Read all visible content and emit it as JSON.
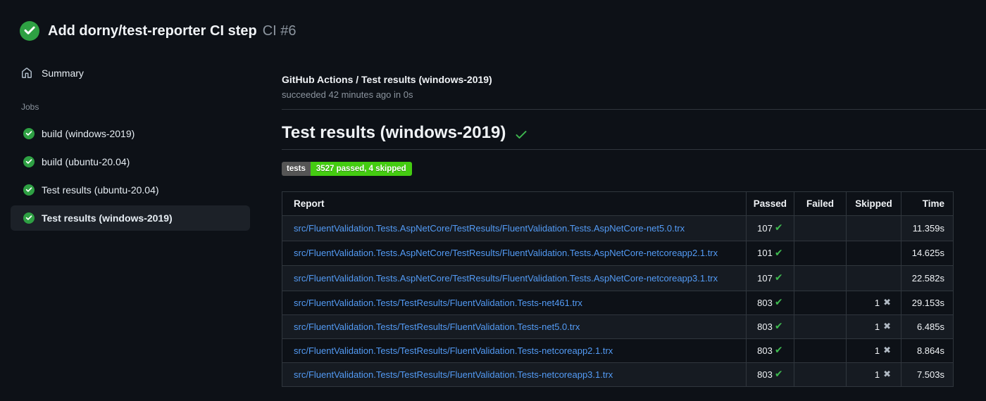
{
  "colors": {
    "bg": "#0d1117",
    "text": "#e6edf3",
    "muted": "#8b949e",
    "link": "#539bf5",
    "border": "#30363d",
    "row-alt": "#161b22",
    "selected-bg": "#1c2128",
    "success-green": "#2ea043",
    "check-green": "#3fb950",
    "skip-gray": "#b1bac4",
    "badge-label-bg": "#555555",
    "badge-value-bg": "#44cc11"
  },
  "run_header": {
    "title": "Add dorny/test-reporter CI step",
    "run_number": "CI #6"
  },
  "sidebar": {
    "summary_label": "Summary",
    "jobs_heading": "Jobs",
    "jobs": [
      {
        "label": "build (windows-2019)",
        "selected": false
      },
      {
        "label": "build (ubuntu-20.04)",
        "selected": false
      },
      {
        "label": "Test results (ubuntu-20.04)",
        "selected": false
      },
      {
        "label": "Test results (windows-2019)",
        "selected": true
      }
    ]
  },
  "main": {
    "check_title": "GitHub Actions / Test results (windows-2019)",
    "check_status": "succeeded 42 minutes ago in 0s",
    "section_title": "Test results (windows-2019)",
    "badge": {
      "label": "tests",
      "value": "3527 passed, 4 skipped"
    },
    "table": {
      "headers": {
        "report": "Report",
        "passed": "Passed",
        "failed": "Failed",
        "skipped": "Skipped",
        "time": "Time"
      },
      "rows": [
        {
          "report": "src/FluentValidation.Tests.AspNetCore/TestResults/FluentValidation.Tests.AspNetCore-net5.0.trx",
          "passed": "107",
          "failed": "",
          "skipped": "",
          "time": "11.359s"
        },
        {
          "report": "src/FluentValidation.Tests.AspNetCore/TestResults/FluentValidation.Tests.AspNetCore-netcoreapp2.1.trx",
          "passed": "101",
          "failed": "",
          "skipped": "",
          "time": "14.625s"
        },
        {
          "report": "src/FluentValidation.Tests.AspNetCore/TestResults/FluentValidation.Tests.AspNetCore-netcoreapp3.1.trx",
          "passed": "107",
          "failed": "",
          "skipped": "",
          "time": "22.582s"
        },
        {
          "report": "src/FluentValidation.Tests/TestResults/FluentValidation.Tests-net461.trx",
          "passed": "803",
          "failed": "",
          "skipped": "1",
          "time": "29.153s"
        },
        {
          "report": "src/FluentValidation.Tests/TestResults/FluentValidation.Tests-net5.0.trx",
          "passed": "803",
          "failed": "",
          "skipped": "1",
          "time": "6.485s"
        },
        {
          "report": "src/FluentValidation.Tests/TestResults/FluentValidation.Tests-netcoreapp2.1.trx",
          "passed": "803",
          "failed": "",
          "skipped": "1",
          "time": "8.864s"
        },
        {
          "report": "src/FluentValidation.Tests/TestResults/FluentValidation.Tests-netcoreapp3.1.trx",
          "passed": "803",
          "failed": "",
          "skipped": "1",
          "time": "7.503s"
        }
      ]
    }
  }
}
